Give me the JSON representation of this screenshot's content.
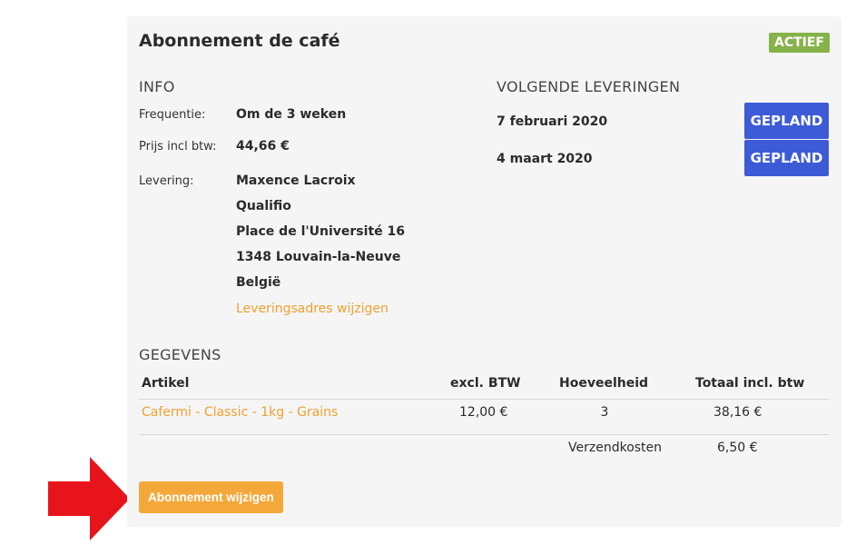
{
  "title": "Abonnement de café",
  "status": "ACTIEF",
  "info": {
    "heading": "INFO",
    "frequency_label": "Frequentie:",
    "frequency_value": "Om de 3 weken",
    "price_label": "Prijs incl btw:",
    "price_value": "44,66 €",
    "delivery_label": "Levering:",
    "address": [
      "Maxence Lacroix",
      "Qualifio",
      "Place de l'Université 16",
      "1348 Louvain-la-Neuve",
      "België"
    ],
    "change_address_link": "Leveringsadres wijzigen"
  },
  "deliveries": {
    "heading": "VOLGENDE LEVERINGEN",
    "items": [
      {
        "date": "7 februari 2020",
        "status": "GEPLAND"
      },
      {
        "date": "4 maart 2020",
        "status": "GEPLAND"
      }
    ]
  },
  "details": {
    "heading": "GEGEVENS",
    "columns": [
      "Artikel",
      "excl. BTW",
      "Hoeveelheid",
      "Totaal incl. btw"
    ],
    "rows": [
      {
        "article": "Cafermi - Classic - 1kg - Grains",
        "excl": "12,00 €",
        "qty": "3",
        "total": "38,16 €"
      }
    ],
    "shipping_label": "Verzendkosten",
    "shipping_value": "6,50 €"
  },
  "actions": {
    "edit_button": "Abonnement wijzigen"
  },
  "colors": {
    "accent_orange": "#f5a83a",
    "status_green": "#86b24a",
    "scheduled_blue": "#3d5bd6",
    "arrow_red": "#e8141c"
  }
}
